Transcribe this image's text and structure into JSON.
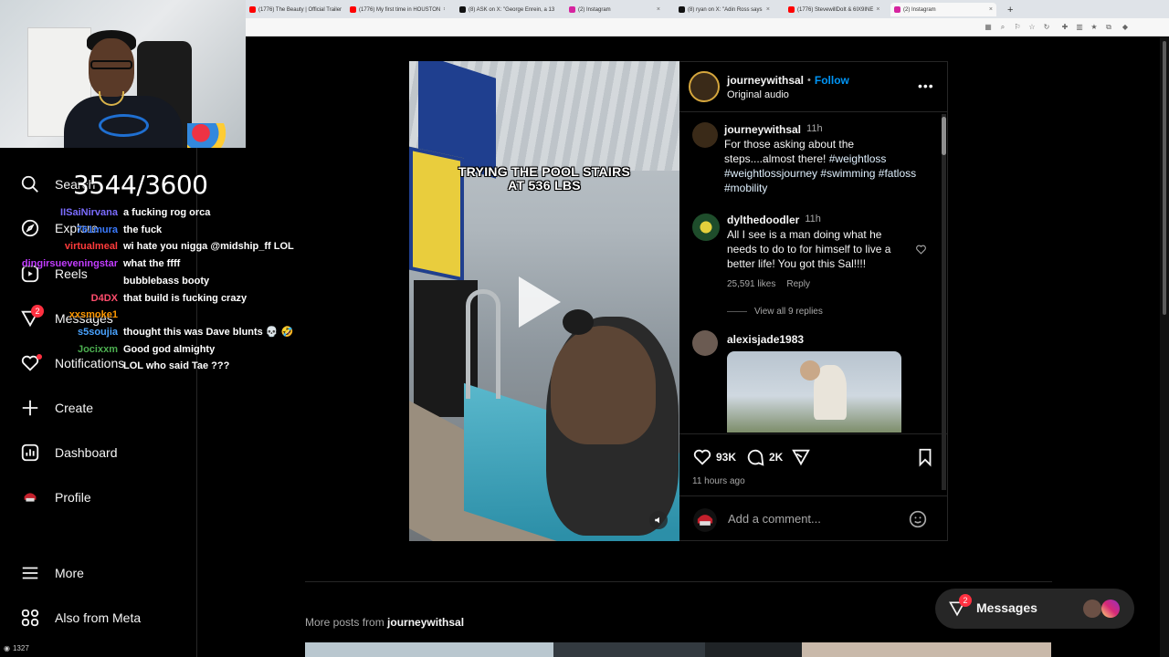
{
  "browser": {
    "tabs": [
      {
        "title": "(1776) The Beauty | Official Trailer",
        "color": "#ff0000"
      },
      {
        "title": "(1776) My first time in HOUSTON",
        "color": "#ff0000"
      },
      {
        "title": "(8) ASK on X: \"George Enrein, a 13",
        "color": "#111111"
      },
      {
        "title": "(2) Instagram",
        "color": "#d6249f"
      },
      {
        "title": "(8) ryan on X: \"Adin Ross says",
        "color": "#111111"
      },
      {
        "title": "(1776) StevewillDoIt & 6IX9INE",
        "color": "#ff0000"
      },
      {
        "title": "(2) Instagram",
        "color": "#d6249f",
        "active": true
      }
    ]
  },
  "stream": {
    "counter": "3544/3600",
    "viewer_count": "1327",
    "chat": [
      {
        "user": "IISaiNirvana",
        "msg": "a fucking rog orca",
        "color": "#7b6cff"
      },
      {
        "user": "761mura",
        "msg": "the fuck",
        "color": "#3b7bff"
      },
      {
        "user": "virtualmeal",
        "msg": "wi hate you nigga @midship_ff LOL",
        "color": "#ff3b3b"
      },
      {
        "user": "dingirsueveningstar",
        "msg": "what the ffff",
        "color": "#c23cff"
      },
      {
        "user": "",
        "msg": "bubblebass booty",
        "color": "#2ecc71"
      },
      {
        "user": "D4DX",
        "msg": "that build is fucking crazy",
        "color": "#ff4d6d"
      },
      {
        "user": "xxsmoke1",
        "msg": "",
        "color": "#ff9800"
      },
      {
        "user": "s5soujia",
        "msg": "thought this was Dave blunts 💀 🤣",
        "color": "#4aa3ff"
      },
      {
        "user": "Jocixxm",
        "msg": "Good god almighty",
        "color": "#4caf50"
      },
      {
        "user": "",
        "msg": "LOL who said Tae ???",
        "color": "#999999"
      }
    ]
  },
  "nav": {
    "search": "Search",
    "explore": "Explore",
    "reels": "Reels",
    "messages": "Messages",
    "messages_badge": "2",
    "notifications": "Notifications",
    "create": "Create",
    "dashboard": "Dashboard",
    "profile": "Profile",
    "more": "More",
    "also_from_meta": "Also from Meta"
  },
  "post": {
    "video_title_line1": "TRYING THE POOL STAIRS",
    "video_title_line2": "AT 536 LBS",
    "author": "journeywithsal",
    "follow": "Follow",
    "audio": "Original audio",
    "caption_time": "11h",
    "caption_line1": "For those asking about the",
    "caption_line2": "steps....almost there!",
    "tags": [
      "#weightloss",
      "#weightlossjourney",
      "#swimming",
      "#fatloss",
      "#mobility"
    ],
    "comments": [
      {
        "user": "dylthedoodler",
        "time": "11h",
        "lines": [
          "All I see is a man doing what he",
          "needs to do to for himself to live a",
          "better life! You got this Sal!!!!"
        ],
        "likes": "25,591 likes",
        "reply": "Reply",
        "view_replies": "View all 9 replies"
      },
      {
        "user": "alexisjade1983"
      }
    ],
    "likes": "93K",
    "comments_count": "2K",
    "time_ago": "11 hours ago",
    "add_comment_placeholder": "Add a comment..."
  },
  "more_posts": {
    "label": "More posts from",
    "user": "journeywithsal"
  },
  "messages_pill": {
    "label": "Messages",
    "badge": "2"
  }
}
